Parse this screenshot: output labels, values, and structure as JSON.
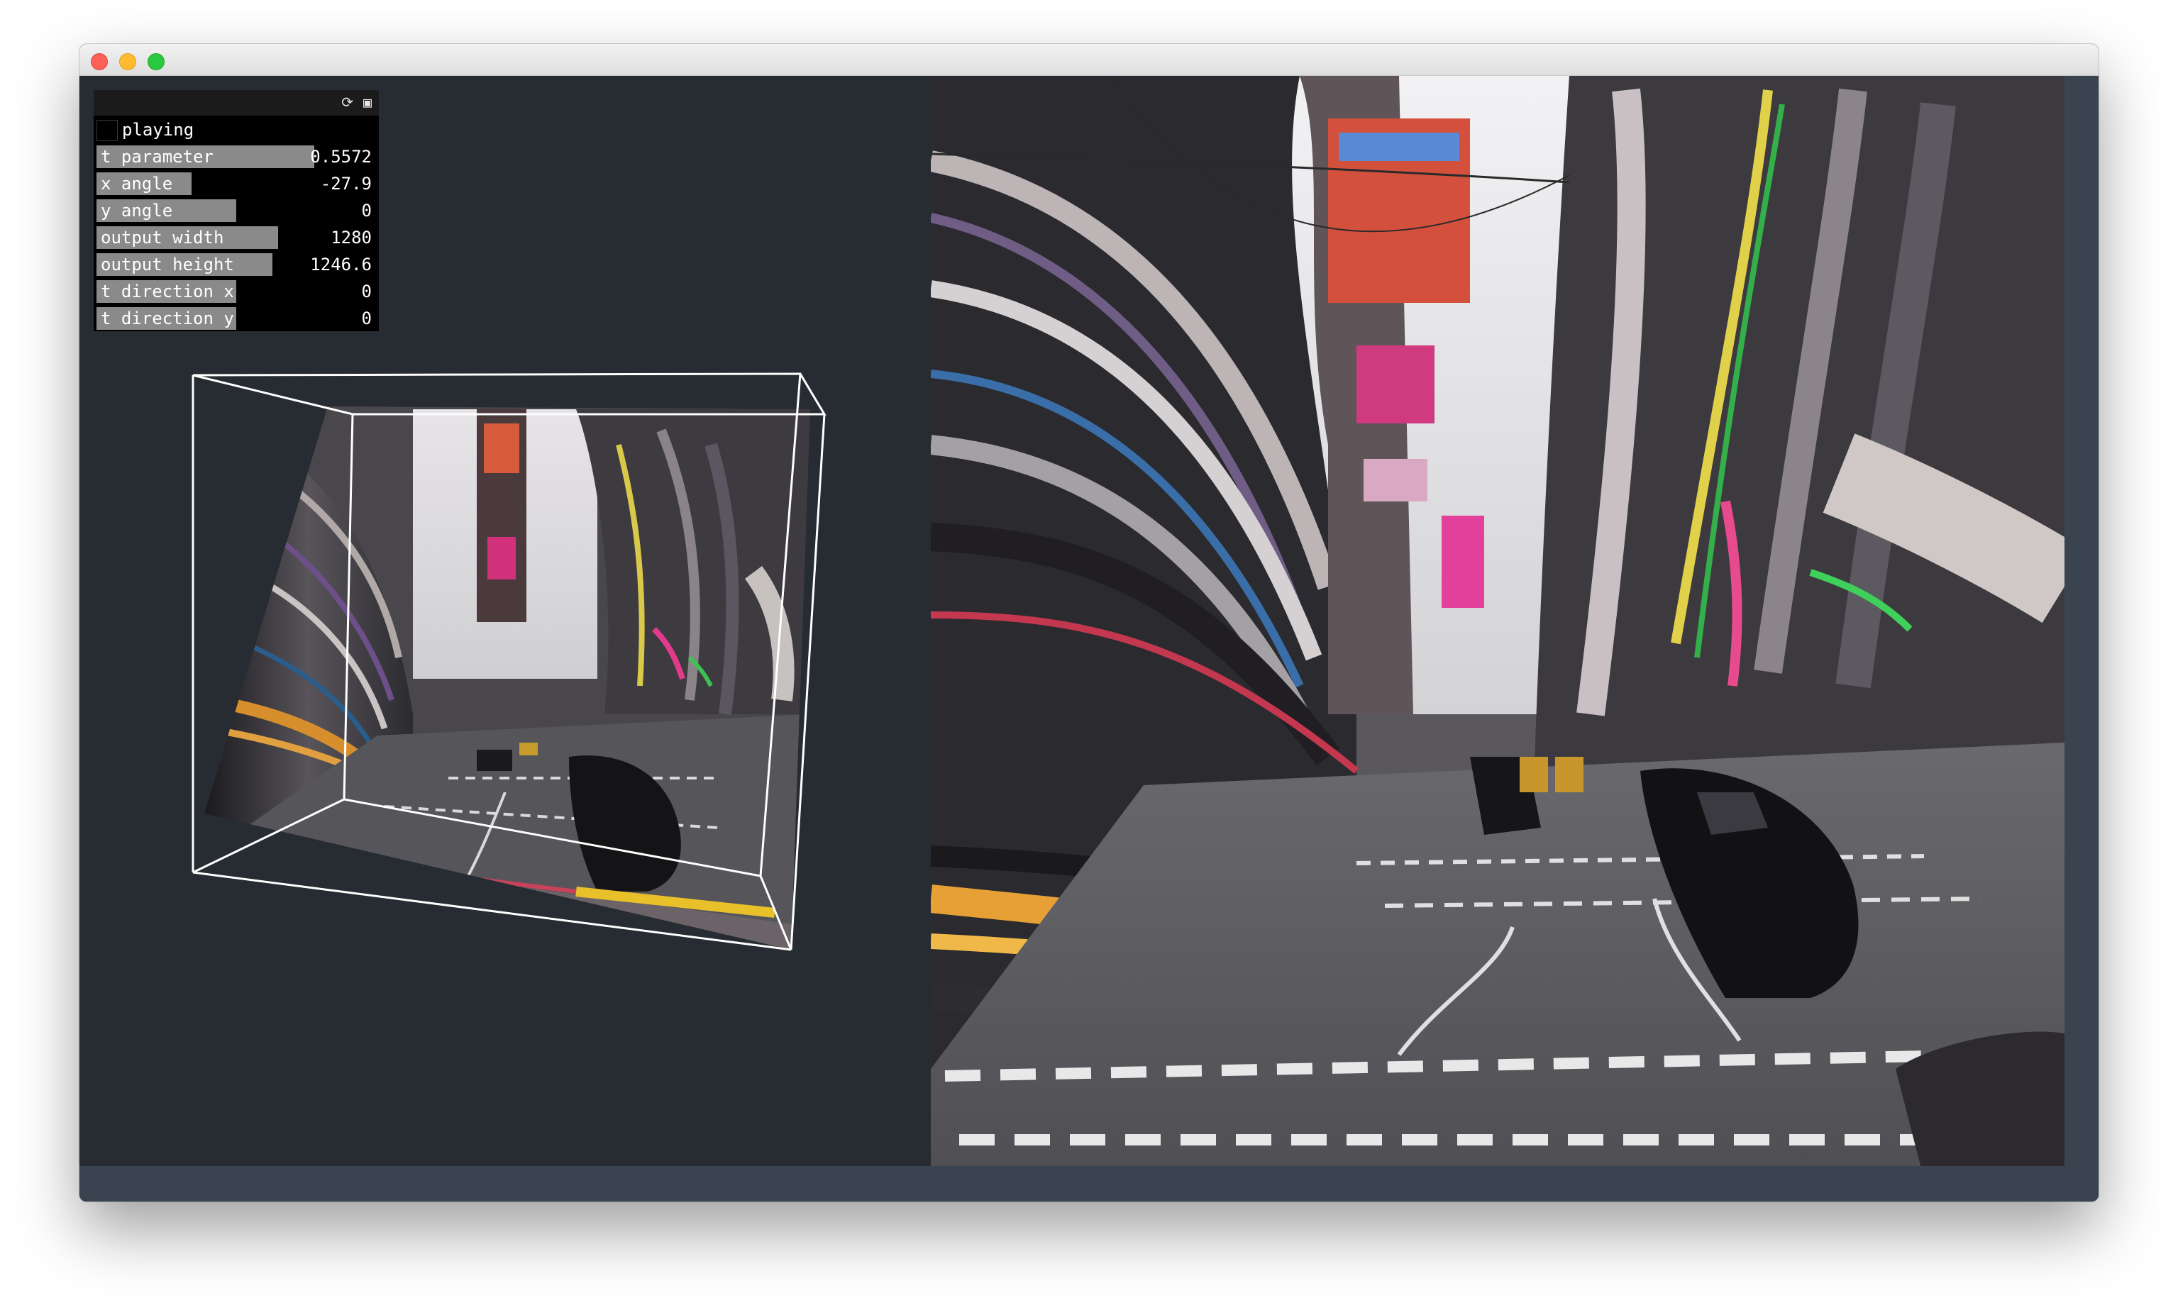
{
  "controls": {
    "toggle": {
      "label": "playing",
      "checked": false
    },
    "params": [
      {
        "label": "t parameter",
        "value": "0.5572",
        "fraction": 0.78
      },
      {
        "label": "x angle",
        "value": "-27.9",
        "fraction": 0.34
      },
      {
        "label": "y angle",
        "value": "0",
        "fraction": 0.5
      },
      {
        "label": "output width",
        "value": "1280",
        "fraction": 0.65
      },
      {
        "label": "output height",
        "value": "1246.6",
        "fraction": 0.63
      },
      {
        "label": "t direction x",
        "value": "0",
        "fraction": 0.5
      },
      {
        "label": "t direction y",
        "value": "0",
        "fraction": 0.5
      }
    ]
  },
  "icons": {
    "refresh": "refresh-icon",
    "save": "save-icon"
  },
  "colors": {
    "background": "#262c31",
    "panel": "#000000",
    "slider_fill": "#8a8a8a",
    "strip": "#3a4450"
  }
}
